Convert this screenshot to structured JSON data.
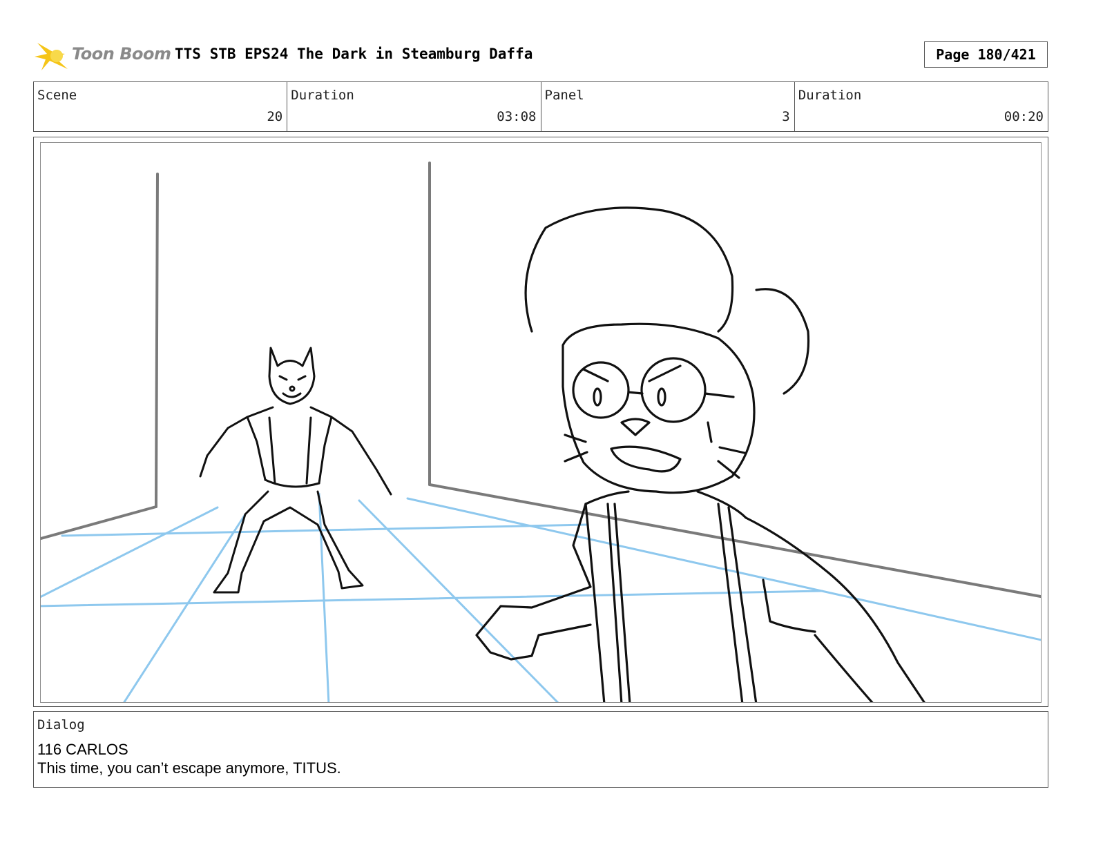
{
  "header": {
    "logo_text": "Toon Boom",
    "title": "TTS STB EPS24 The Dark in Steamburg Daffa",
    "page": "Page 180/421"
  },
  "info": {
    "scene_label": "Scene",
    "scene_value": "20",
    "scene_duration_label": "Duration",
    "scene_duration_value": "03:08",
    "panel_label": "Panel",
    "panel_value": "3",
    "panel_duration_label": "Duration",
    "panel_duration_value": "00:20"
  },
  "dialog": {
    "label": "Dialog",
    "lines": [
      "116 CARLOS",
      "This time, you can’t escape anymore, TITUS."
    ]
  },
  "colors": {
    "logo_yellow": "#f5c518",
    "perspective_blue": "#8ec8ee",
    "wall_gray": "#7a7a7a"
  }
}
